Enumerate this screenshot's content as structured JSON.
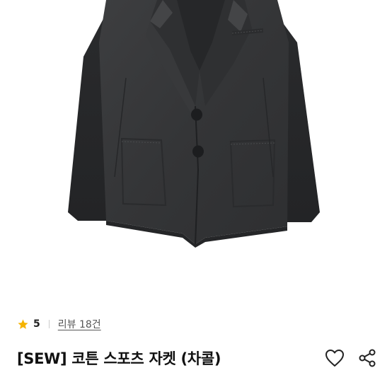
{
  "product": {
    "image_alt_icon": "jacket-product-image",
    "rating": "5",
    "review_label": "리뷰 18건",
    "title": "[SEW] 코튼 스포츠 자켓 (차콜)"
  },
  "icons": {
    "rating": "star-icon",
    "wishlist": "heart-outline-icon",
    "share": "share-icon"
  },
  "colors": {
    "star": "#F5B301",
    "jacket": "#3A3B3C",
    "text": "#111111"
  }
}
